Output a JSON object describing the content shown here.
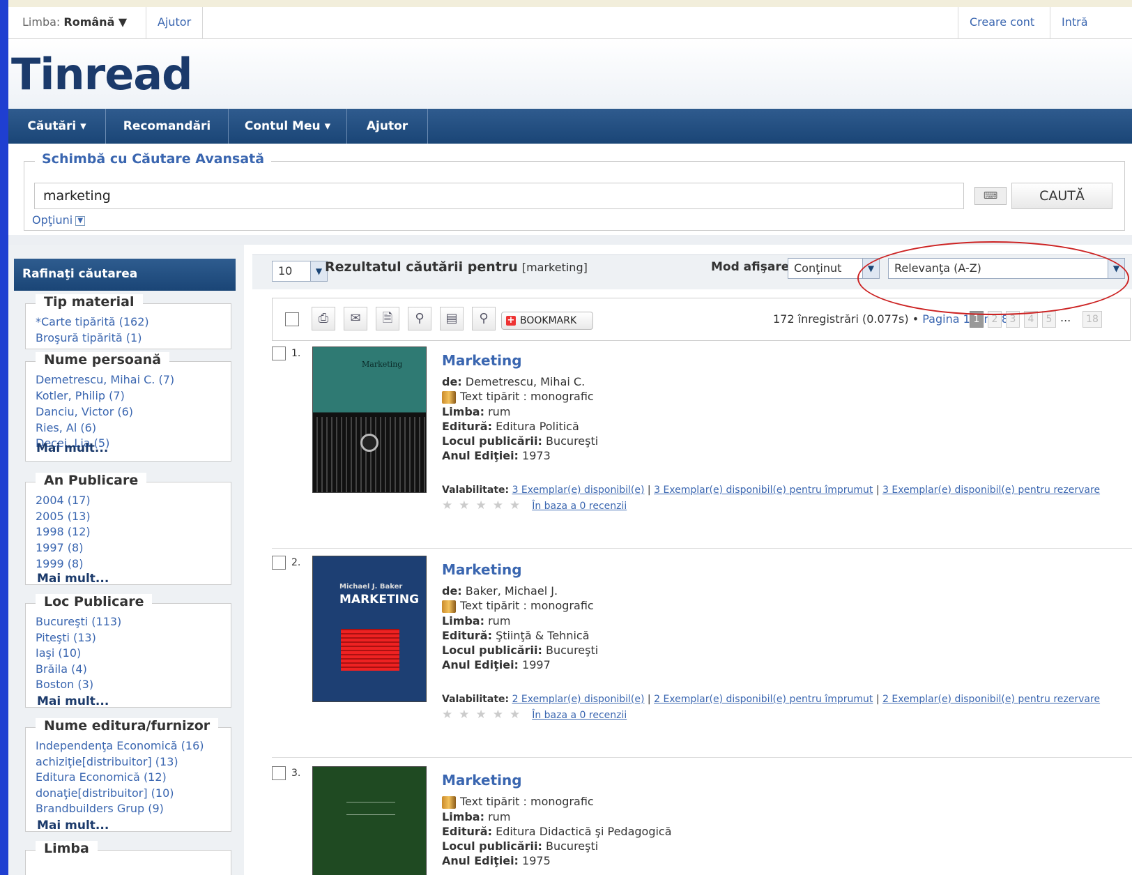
{
  "topbar": {
    "language_label": "Limba:",
    "language_value": "Română ▼",
    "help": "Ajutor",
    "create_account": "Creare cont",
    "login": "Intră"
  },
  "logo": {
    "text": "Tinread"
  },
  "nav": [
    "Căutări ▾",
    "Recomandări",
    "Contul Meu ▾",
    "Ajutor"
  ],
  "search": {
    "legend": "Schimbă cu  Căutare Avansată",
    "query": "marketing",
    "button": "CAUTĂ",
    "options": "Opţiuni"
  },
  "sidebar": {
    "title": "Rafinaţi căutarea",
    "facets": [
      {
        "title": "Tip material",
        "items": [
          "*Carte tipărită (162)",
          "Broşură tipărită (1)"
        ],
        "more": ""
      },
      {
        "title": "Nume persoană",
        "items": [
          "Demetrescu, Mihai C. (7)",
          "Kotler, Philip (7)",
          "Danciu, Victor (6)",
          "Ries, Al (6)",
          "Decei, Lia (5)"
        ],
        "more": "Mai mult..."
      },
      {
        "title": "An Publicare",
        "items": [
          "2004 (17)",
          "2005 (13)",
          "1998 (12)",
          "1997 (8)",
          "1999 (8)"
        ],
        "more": "Mai mult..."
      },
      {
        "title": "Loc Publicare",
        "items": [
          "Bucureşti (113)",
          "Piteşti (13)",
          "Iaşi (10)",
          "Brăila (4)",
          "Boston (3)"
        ],
        "more": "Mai mult..."
      },
      {
        "title": "Nume editura/furnizor",
        "items": [
          "Independenţa Economică (16)",
          "achiziţie[distribuitor] (13)",
          "Editura Economică (12)",
          "donaţie[distribuitor] (10)",
          "Brandbuilders Grup (9)"
        ],
        "more": "Mai mult..."
      },
      {
        "title": "Limba",
        "items": [],
        "more": ""
      }
    ]
  },
  "results_header": {
    "per_page": "10",
    "title_bold": "Rezultatul căutării pentru",
    "title_query": "[marketing]",
    "display_mode_label": "Mod afişare",
    "display_mode": "Conţinut",
    "sort": "Relevanţa (A-Z)",
    "bookmark": "BOOKMARK",
    "count_text": "172 înregistrări (0.077s)",
    "page_text": "Pagina 1 din 18",
    "pages": [
      "1",
      "2",
      "3",
      "4",
      "5"
    ],
    "dots": "...",
    "last_page": "18"
  },
  "records": [
    {
      "num": "1.",
      "title": "Marketing",
      "author_label": "de:",
      "author": "Demetrescu, Mihai C.",
      "type": "Text tipărit : monografic",
      "lang_label": "Limba:",
      "lang": "rum",
      "pub_label": "Editură:",
      "pub": "Editura Politică",
      "place_label": "Locul publicării:",
      "place": "Bucureşti",
      "year_label": "Anul Ediţiei:",
      "year": "1973",
      "avail_label": "Valabilitate:",
      "avail_1": "3 Exemplar(e) disponibil(e)",
      "avail_2": "3 Exemplar(e) disponibil(e) pentru împrumut",
      "avail_3": "3 Exemplar(e) disponibil(e) pentru rezervare",
      "reviews": "În baza a 0 recenzii",
      "cover_text_top": "Marketing",
      "cover_color": "#2f7a73"
    },
    {
      "num": "2.",
      "title": "Marketing",
      "author_label": "de:",
      "author": "Baker, Michael J.",
      "type": "Text tipărit : monografic",
      "lang_label": "Limba:",
      "lang": "rum",
      "pub_label": "Editură:",
      "pub": "Ştiinţă & Tehnică",
      "place_label": "Locul publicării:",
      "place": "Bucureşti",
      "year_label": "Anul Ediţiei:",
      "year": "1997",
      "avail_label": "Valabilitate:",
      "avail_1": "2 Exemplar(e) disponibil(e)",
      "avail_2": "2 Exemplar(e) disponibil(e) pentru împrumut",
      "avail_3": "2 Exemplar(e) disponibil(e) pentru rezervare",
      "reviews": "În baza a 0 recenzii",
      "cover_text_top": "Michael J. Baker",
      "cover_text_main": "MARKETING",
      "cover_color": "#1d3f73"
    },
    {
      "num": "3.",
      "title": "Marketing",
      "type": "Text tipărit : monografic",
      "lang_label": "Limba:",
      "lang": "rum",
      "pub_label": "Editură:",
      "pub": "Editura Didactică şi Pedagogică",
      "place_label": "Locul publicării:",
      "place": "Bucureşti",
      "year_label": "Anul Ediţiei:",
      "year": "1975",
      "cover_color": "#1f4a22"
    }
  ]
}
